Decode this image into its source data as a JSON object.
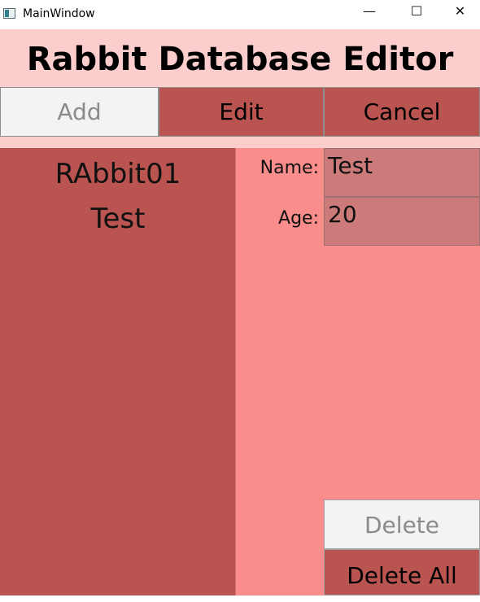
{
  "window": {
    "title": "MainWindow",
    "controls": {
      "minimize": "—",
      "maximize": "☐",
      "close": "✕"
    }
  },
  "header": {
    "title": "Rabbit Database Editor"
  },
  "toolbar": {
    "add_label": "Add",
    "edit_label": "Edit",
    "cancel_label": "Cancel"
  },
  "rabbit_list": {
    "items": [
      "RAbbit01",
      "Test"
    ]
  },
  "details": {
    "name_label": "Name:",
    "name_value": "Test",
    "age_label": "Age:",
    "age_value": "20"
  },
  "actions": {
    "delete_label": "Delete",
    "delete_all_label": "Delete All"
  },
  "colors": {
    "header_bg": "#fbcdcd",
    "accent_red": "#b95450",
    "detail_bg": "#f98d8b",
    "input_bg": "#cd7a7a",
    "disabled_bg": "#f3f3f3"
  }
}
